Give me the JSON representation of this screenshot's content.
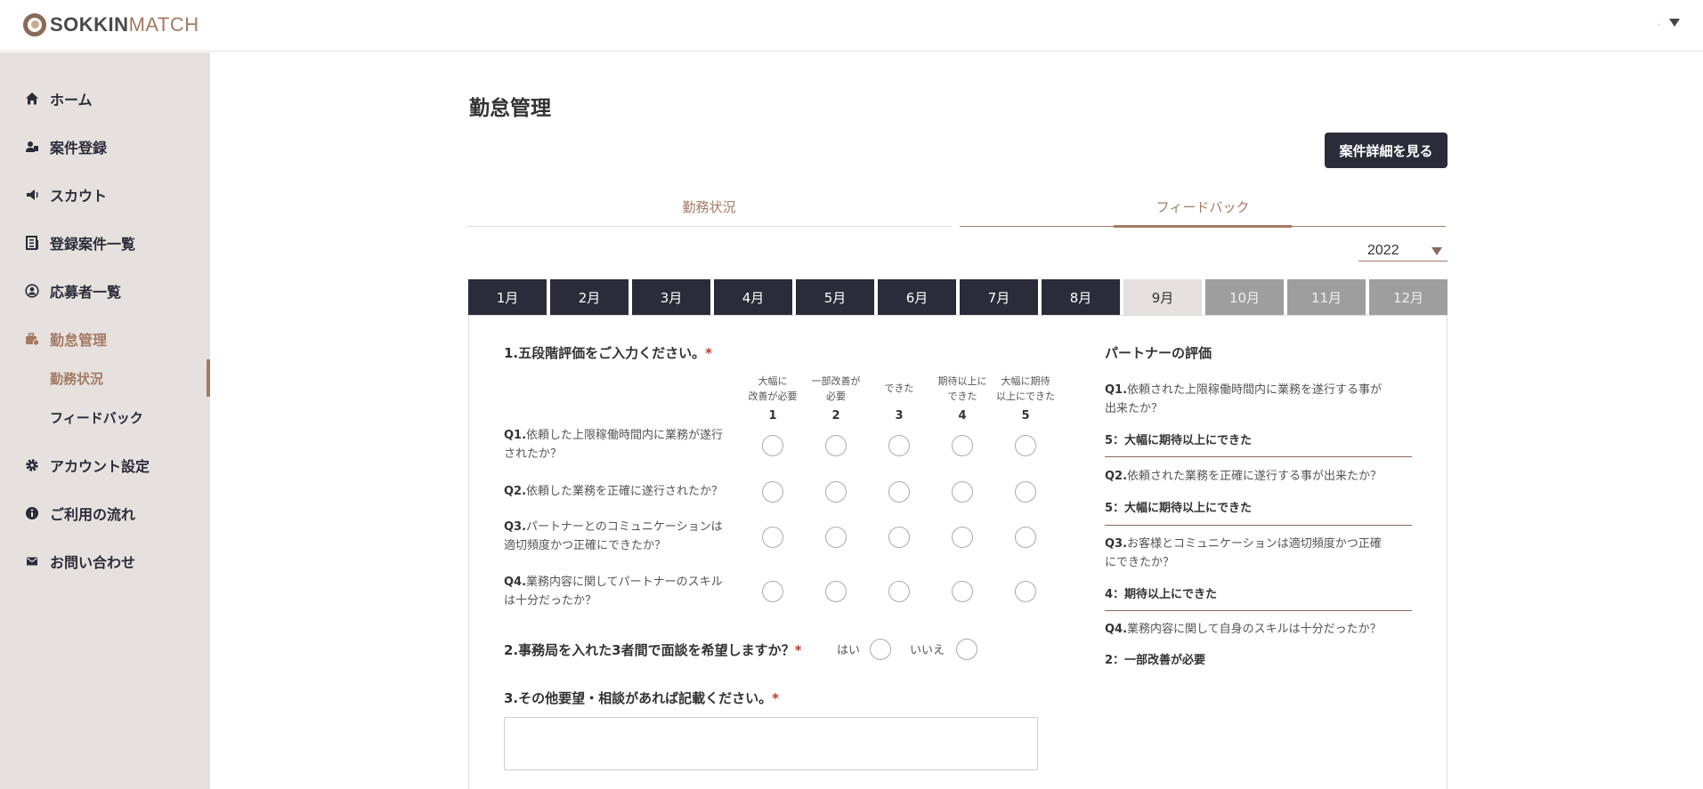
{
  "header": {
    "logo_bold": "SOKKIN",
    "logo_light": "MATCH",
    "user_name": "."
  },
  "sidebar": {
    "items": [
      {
        "label": "ホーム",
        "icon": "home-icon"
      },
      {
        "label": "案件登録",
        "icon": "project-register-icon"
      },
      {
        "label": "スカウト",
        "icon": "megaphone-icon"
      },
      {
        "label": "登録案件一覧",
        "icon": "list-icon"
      },
      {
        "label": "応募者一覧",
        "icon": "user-circle-icon"
      },
      {
        "label": "勤怠管理",
        "icon": "briefcase-icon"
      },
      {
        "label": "アカウント設定",
        "icon": "gear-icon"
      },
      {
        "label": "ご利用の流れ",
        "icon": "info-icon"
      },
      {
        "label": "お問い合わせ",
        "icon": "mail-icon"
      }
    ],
    "sub_items": [
      {
        "label": "勤務状況"
      },
      {
        "label": "フィードバック"
      }
    ],
    "accent_color": "#a47a63"
  },
  "main": {
    "title": "勤怠管理",
    "detail_button": "案件詳細を見る",
    "tabs": [
      {
        "label": "勤務状況"
      },
      {
        "label": "フィードバック",
        "selected": true
      }
    ],
    "year": "2022",
    "months": [
      "1月",
      "2月",
      "3月",
      "4月",
      "5月",
      "6月",
      "7月",
      "8月",
      "9月",
      "10月",
      "11月",
      "12月"
    ],
    "current_month": "9月"
  },
  "form": {
    "q1_heading": "1.五段階評価をご入力ください。",
    "required_mark": "*",
    "scale": [
      {
        "line1": "大幅に",
        "line2": "改善が必要",
        "num": "1"
      },
      {
        "line1": "一部改善が",
        "line2": "必要",
        "num": "2"
      },
      {
        "line1": "できた",
        "line2": "",
        "num": "3"
      },
      {
        "line1": "期待以上に",
        "line2": "できた",
        "num": "4"
      },
      {
        "line1": "大幅に期待",
        "line2": "以上にできた",
        "num": "5"
      }
    ],
    "questions": [
      {
        "no": "Q1.",
        "line1": "依頼した上限稼働時間内に業務が遂行",
        "line2": "されたか？"
      },
      {
        "no": "Q2.",
        "line1": "依頼した業務を正確に遂行されたか？",
        "line2": ""
      },
      {
        "no": "Q3.",
        "line1": "パートナーとのコミュニケーションは",
        "line2": "適切頻度かつ正確にできたか？"
      },
      {
        "no": "Q4.",
        "line1": "業務内容に関してパートナーのスキル",
        "line2": "は十分だったか？"
      }
    ],
    "q2_heading": "2.事務局を入れた3者間で面談を希望しますか？",
    "yes_label": "はい",
    "no_label": "いいえ",
    "q3_heading": "3.その他要望・相談があれば記載ください。",
    "textarea_value": ""
  },
  "partner_eval": {
    "title": "パートナーの評価",
    "items": [
      {
        "no": "Q1.",
        "line1": "依頼された上限稼働時間内に業務を遂行する事が",
        "line2": "出来たか？",
        "answer": "5：大幅に期待以上にできた"
      },
      {
        "no": "Q2.",
        "line1": "依頼された業務を正確に遂行する事が出来たか？",
        "line2": "",
        "answer": "5：大幅に期待以上にできた"
      },
      {
        "no": "Q3.",
        "line1": "お客様とコミュニケーションは適切頻度かつ正確",
        "line2": "にできたか？",
        "answer": "4：期待以上にできた"
      },
      {
        "no": "Q4.",
        "line1": "業務内容に関して自身のスキルは十分だったか？",
        "line2": "",
        "answer": "2：一部改善が必要"
      }
    ]
  }
}
